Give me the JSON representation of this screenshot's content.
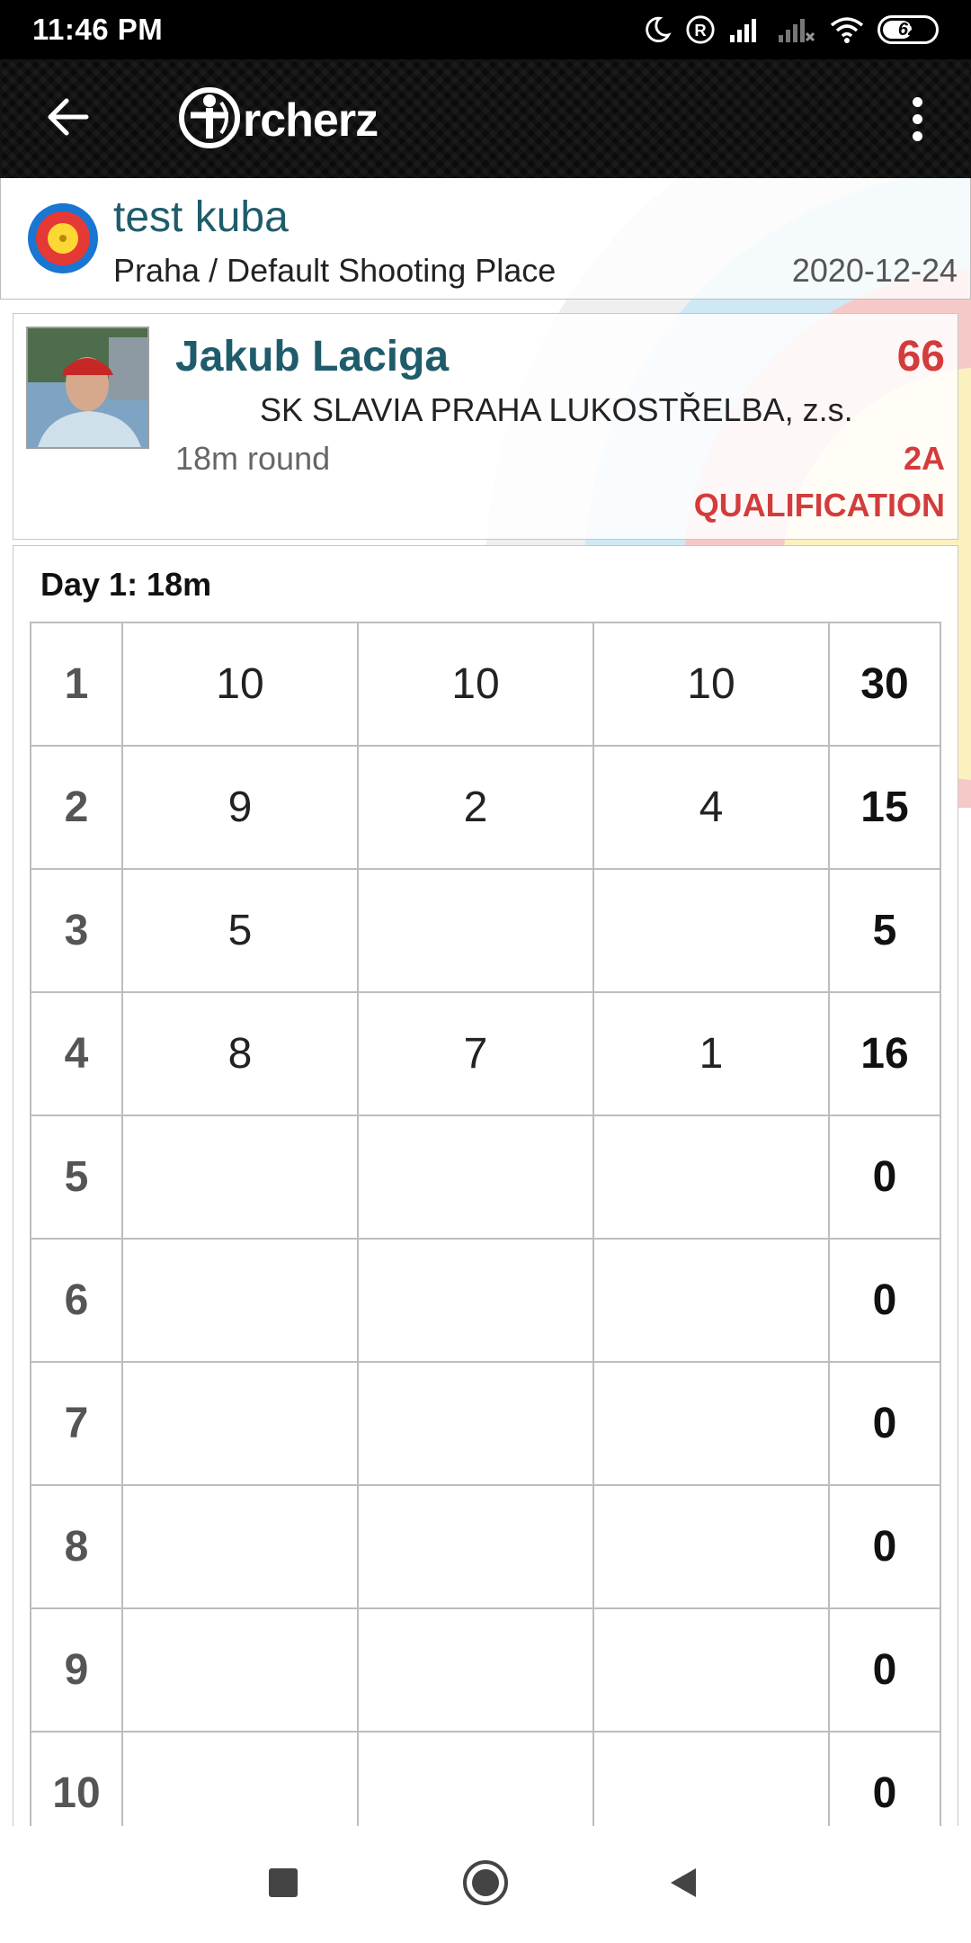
{
  "status_bar": {
    "time": "11:46 PM",
    "battery": "62",
    "battery_level": 0.62,
    "icons": [
      "moon-icon",
      "registered-icon",
      "signal-icon",
      "signal-no-service-icon",
      "wifi-icon",
      "battery-icon"
    ]
  },
  "app_bar": {
    "logo_text": "rcherz",
    "back_icon": "arrow-left-icon",
    "menu_icon": "more-vertical-icon"
  },
  "event": {
    "title": "test kuba",
    "place": "Praha / Default Shooting Place",
    "date": "2020-12-24",
    "icon": "archery-target-icon"
  },
  "archer": {
    "name": "Jakub Laciga",
    "score": "66",
    "club": "SK SLAVIA PRAHA LUKOSTŘELBA, z.s.",
    "round": "18m round",
    "target": "2A",
    "stage": "QUALIFICATION"
  },
  "scorecard": {
    "day_label": "Day 1: 18m",
    "ends": [
      {
        "no": "1",
        "arrows": [
          "10",
          "10",
          "10"
        ],
        "sum": "30"
      },
      {
        "no": "2",
        "arrows": [
          "9",
          "2",
          "4"
        ],
        "sum": "15"
      },
      {
        "no": "3",
        "arrows": [
          "5",
          "",
          ""
        ],
        "sum": "5"
      },
      {
        "no": "4",
        "arrows": [
          "8",
          "7",
          "1"
        ],
        "sum": "16"
      },
      {
        "no": "5",
        "arrows": [
          "",
          "",
          ""
        ],
        "sum": "0"
      },
      {
        "no": "6",
        "arrows": [
          "",
          "",
          ""
        ],
        "sum": "0"
      },
      {
        "no": "7",
        "arrows": [
          "",
          "",
          ""
        ],
        "sum": "0"
      },
      {
        "no": "8",
        "arrows": [
          "",
          "",
          ""
        ],
        "sum": "0"
      },
      {
        "no": "9",
        "arrows": [
          "",
          "",
          ""
        ],
        "sum": "0"
      },
      {
        "no": "10",
        "arrows": [
          "",
          "",
          ""
        ],
        "sum": "0"
      }
    ]
  },
  "nav_bar": {
    "icons": [
      "recents-square-icon",
      "home-circle-icon",
      "back-triangle-icon"
    ]
  },
  "colors": {
    "accent_teal": "#1f5c6b",
    "score_red": "#d33c3c",
    "app_bar_black": "#0b0b0b"
  }
}
